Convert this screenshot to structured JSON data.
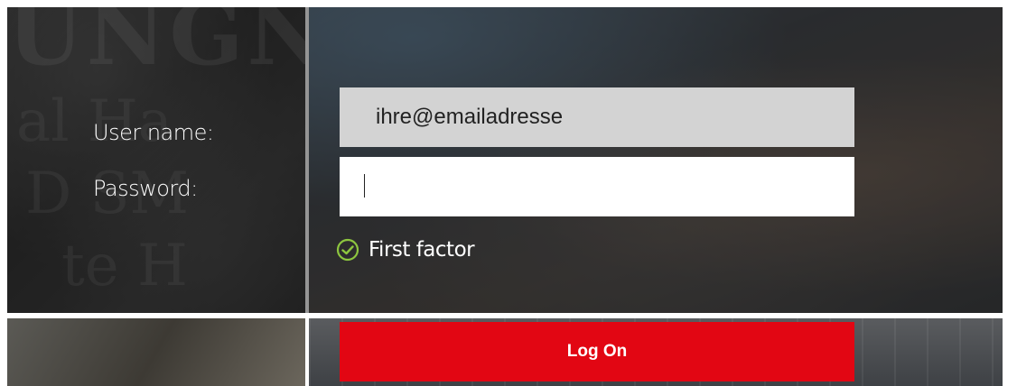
{
  "form": {
    "username_label": "User name:",
    "username_value": "ihre@emailadresse",
    "password_label": "Password:",
    "password_value": "",
    "factor_status": "First factor",
    "logon_label": "Log On"
  },
  "background": {
    "letters_top": "UNGNk",
    "letters_mid": "al Ha",
    "letters_low": "D SM",
    "letters_bottom": "te H"
  },
  "colors": {
    "accent": "#e20613",
    "check": "#8dc63f",
    "username_bg": "#d3d3d3"
  },
  "icons": {
    "factor": "check-circle-icon"
  }
}
